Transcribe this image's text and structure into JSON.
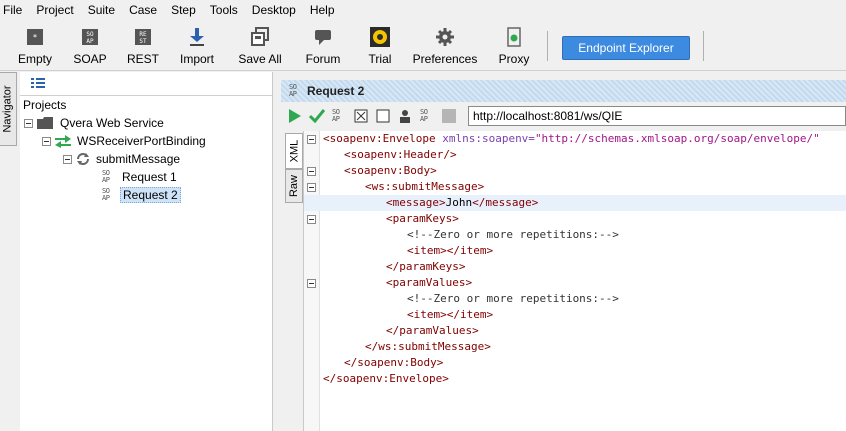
{
  "menu": [
    "File",
    "Project",
    "Suite",
    "Case",
    "Step",
    "Tools",
    "Desktop",
    "Help"
  ],
  "toolbar": {
    "buttons": [
      {
        "label": "Empty",
        "icon": "empty-project-icon"
      },
      {
        "label": "SOAP",
        "icon": "soap-icon"
      },
      {
        "label": "REST",
        "icon": "rest-icon"
      },
      {
        "label": "Import",
        "icon": "import-icon"
      },
      {
        "label": "Save All",
        "icon": "save-all-icon"
      },
      {
        "label": "Forum",
        "icon": "forum-icon"
      },
      {
        "label": "Trial",
        "icon": "trial-icon"
      },
      {
        "label": "Preferences",
        "icon": "gear-icon"
      },
      {
        "label": "Proxy",
        "icon": "proxy-icon"
      }
    ],
    "endpoint_explorer": "Endpoint Explorer"
  },
  "navigator": {
    "tab_label": "Navigator",
    "root": "Projects",
    "project": "Qvera Web Service",
    "binding": "WSReceiverPortBinding",
    "operation": "submitMessage",
    "requests": [
      "Request 1",
      "Request 2"
    ]
  },
  "editor": {
    "title": "Request 2",
    "url": "http://localhost:8081/ws/QIE",
    "side_tabs": [
      "XML",
      "Raw"
    ],
    "soap_icon_text": "SO\nAP",
    "xml": {
      "l1_tag": "<soapenv:Envelope",
      "l1_attr": " xmlns:soapenv=",
      "l1_val": "\"http://schemas.xmlsoap.org/soap/envelope/\"",
      "l2": "<soapenv:Header/>",
      "l3": "<soapenv:Body>",
      "l4": "<ws:submitMessage>",
      "l5_open": "<message>",
      "l5_text": "John",
      "l5_close": "</message>",
      "l6": "<paramKeys>",
      "l7": "<!--Zero or more repetitions:-->",
      "l8_open": "<item>",
      "l8_close": "</item>",
      "l9": "</paramKeys>",
      "l10": "<paramValues>",
      "l11": "<!--Zero or more repetitions:-->",
      "l12_open": "<item>",
      "l12_close": "</item>",
      "l13": "</paramValues>",
      "l14": "</ws:submitMessage>",
      "l15": "</soapenv:Body>",
      "l16": "</soapenv:Envelope>"
    }
  }
}
